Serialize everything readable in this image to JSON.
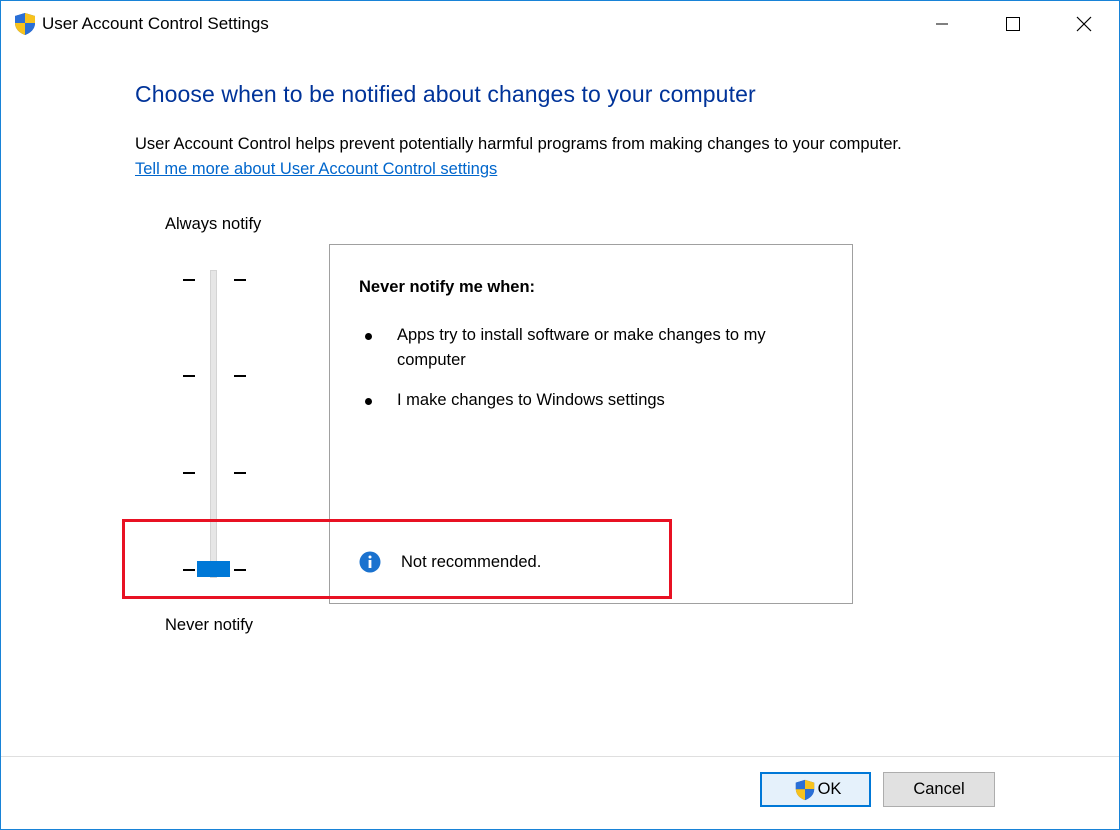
{
  "window": {
    "title": "User Account Control Settings",
    "icon": "uac-shield-icon",
    "controls": [
      "minimize",
      "maximize",
      "close"
    ]
  },
  "header": {
    "heading": "Choose when to be notified about changes to your computer",
    "description": "User Account Control helps prevent potentially harmful programs from making changes to your computer.",
    "help_link": "Tell me more about User Account Control settings"
  },
  "slider": {
    "top_label": "Always notify",
    "bottom_label": "Never notify",
    "levels": 4,
    "selected_level": 1,
    "selected_level_name": "Never notify"
  },
  "info_panel": {
    "heading": "Never notify me when:",
    "bullets": [
      "Apps try to install software or make changes to my computer",
      "I make changes to Windows settings"
    ],
    "recommendation": "Not recommended.",
    "recommendation_icon": "info-icon"
  },
  "buttons": {
    "ok_label": "OK",
    "cancel_label": "Cancel"
  },
  "colors": {
    "heading": "#003399",
    "link": "#0066cc",
    "accent": "#0078d7",
    "highlight": "#e81123"
  }
}
